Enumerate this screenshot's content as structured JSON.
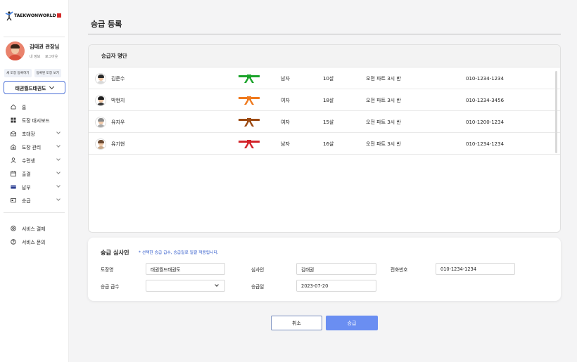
{
  "brand": {
    "logo_text": "TAEKWONWORLD"
  },
  "profile": {
    "name": "김태권 관장님",
    "link_info": "내 정보",
    "link_logout": "로그아웃"
  },
  "mini_buttons": [
    "새 도장 등록하기",
    "등록된 도장 보기"
  ],
  "dojo_select": {
    "value": "태권월드태권도"
  },
  "nav": {
    "items": [
      {
        "label": "홈",
        "icon": "home-icon",
        "expandable": false
      },
      {
        "label": "도장 대시보드",
        "icon": "dashboard-icon",
        "expandable": false
      },
      {
        "label": "초대장",
        "icon": "invitation-icon",
        "expandable": true
      },
      {
        "label": "도장 관리",
        "icon": "dojo-icon",
        "expandable": true
      },
      {
        "label": "수련생",
        "icon": "student-icon",
        "expandable": true
      },
      {
        "label": "출결",
        "icon": "calendar-icon",
        "expandable": true
      },
      {
        "label": "납부",
        "icon": "card-icon",
        "expandable": true
      },
      {
        "label": "승급",
        "icon": "badge-icon",
        "expandable": true
      }
    ],
    "bottom": [
      {
        "label": "서비스 결제",
        "icon": "payment-icon"
      },
      {
        "label": "서비스 문의",
        "icon": "help-icon"
      }
    ]
  },
  "page": {
    "title": "승급 등록"
  },
  "roster": {
    "title": "승급자 명단",
    "rows": [
      {
        "name": "김준수",
        "belt_color": "#1aa32a",
        "gender": "남자",
        "age": "10살",
        "class": "오전 파트 3시 반",
        "phone": "010-1234-1234",
        "hair": "#2b2b2b",
        "shirt": "#d8d8d8"
      },
      {
        "name": "박현지",
        "belt_color": "#ef7a1e",
        "gender": "여자",
        "age": "18살",
        "class": "오전 파트 3시 반",
        "phone": "010-1234-3456",
        "hair": "#1e1e1e",
        "shirt": "#3a3a3a"
      },
      {
        "name": "유지우",
        "belt_color": "#9c4a13",
        "gender": "여자",
        "age": "15살",
        "class": "오전 파트 3시 반",
        "phone": "010-1200-1234",
        "hair": "#8a8a8a",
        "shirt": "#a9a9a9"
      },
      {
        "name": "유기현",
        "belt_color": "#d3232a",
        "gender": "남자",
        "age": "16살",
        "class": "오전 파트 3시 반",
        "phone": "010-1234-1234",
        "hair": "#6b4a32",
        "shirt": "#c9a98a"
      }
    ]
  },
  "grading": {
    "title": "승급 심사인",
    "note": "* 선택한 승급 급수, 승급일로 일괄 적용됩니다.",
    "dojo_label": "도장명",
    "dojo_value": "태권월드태권도",
    "examiner_label": "심사인",
    "examiner_value": "김태권",
    "phone_label": "전화번호",
    "phone_value": "010-1234-1234",
    "grade_label": "승급 급수",
    "grade_value": "",
    "date_label": "승급일",
    "date_value": "2023-07-20"
  },
  "actions": {
    "cancel": "취소",
    "promote": "승급"
  },
  "colors": {
    "accent": "#6a8ef2",
    "note": "#2a55c9",
    "select_border": "#4a6fd6"
  }
}
